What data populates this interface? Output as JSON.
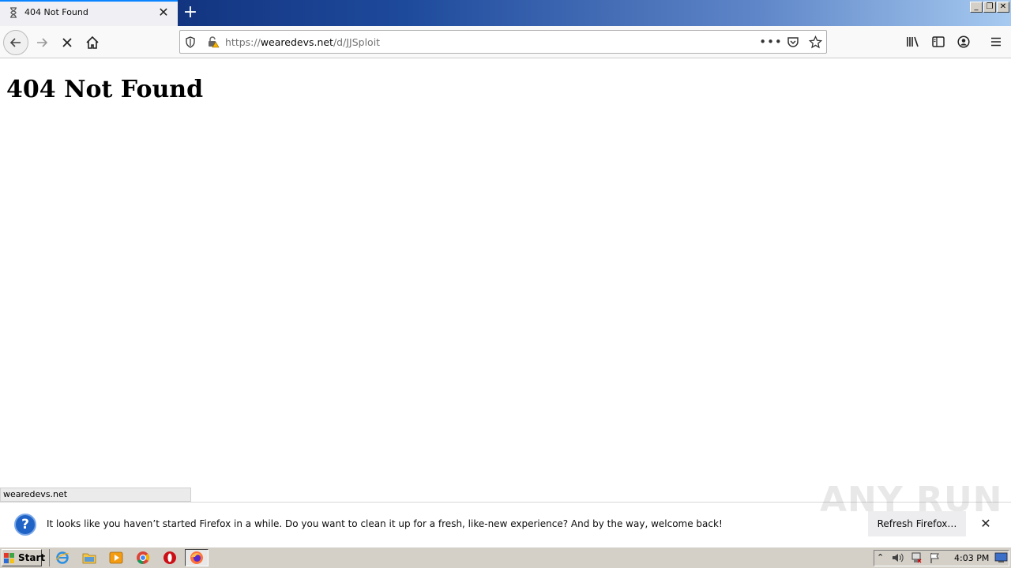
{
  "tab": {
    "title": "404 Not Found",
    "icon": "hourglass-icon"
  },
  "window_controls": [
    "minimize",
    "restore",
    "close"
  ],
  "nav": {
    "url_host": "wearedevs.net",
    "url_prefix": "https://",
    "url_path": "/d/JJSploit"
  },
  "page": {
    "heading": "404 Not Found"
  },
  "status_bar": {
    "text": "wearedevs.net"
  },
  "notification": {
    "text": "It looks like you haven’t started Firefox in a while. Do you want to clean it up for a fresh, like-new experience? And by the way, welcome back!",
    "button": "Refresh Firefox…"
  },
  "watermark": "ANY RUN",
  "taskbar": {
    "start_label": "Start",
    "pinned": [
      "internet-explorer-icon",
      "file-explorer-icon",
      "media-player-icon",
      "chrome-icon",
      "opera-icon",
      "firefox-icon"
    ],
    "clock": "4:03 PM"
  },
  "colors": {
    "accent": "#0a84ff",
    "titlebar_start": "#0a246a",
    "titlebar_end": "#a6caf0",
    "notify_icon": "#1f63c6"
  }
}
